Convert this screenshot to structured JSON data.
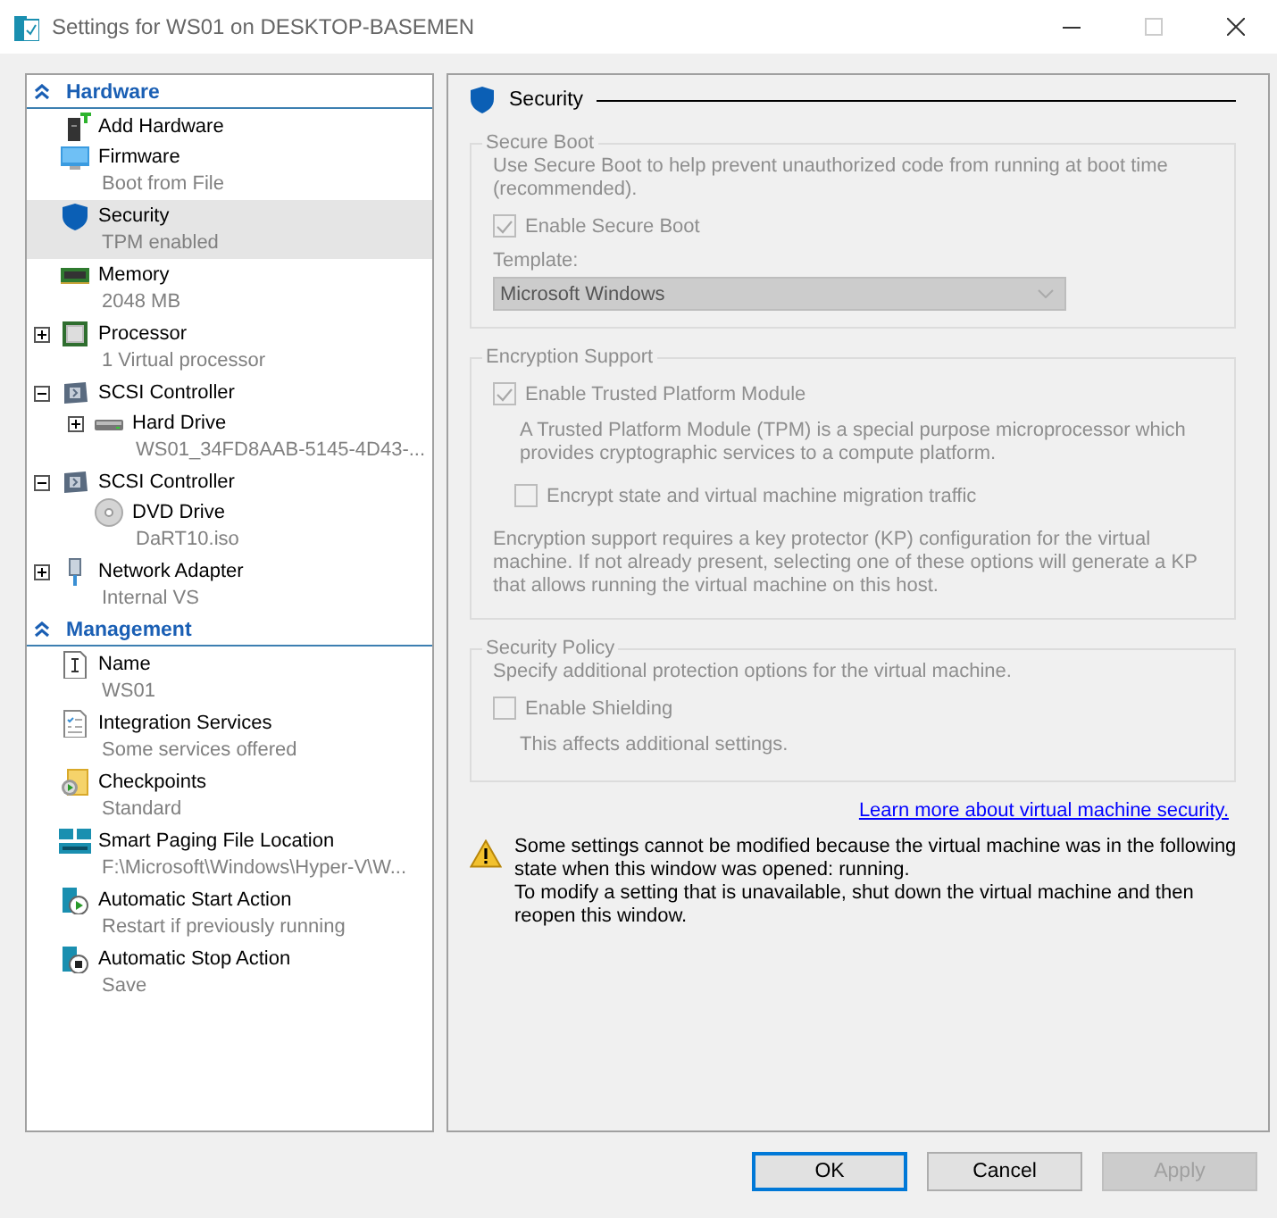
{
  "window": {
    "title": "Settings for WS01 on DESKTOP-BASEMEN"
  },
  "tree": {
    "sections": [
      {
        "title": "Hardware",
        "expanded": true,
        "items": [
          {
            "kind": "add-hardware",
            "name": "Add Hardware",
            "selected": false
          },
          {
            "kind": "firmware",
            "name": "Firmware",
            "detail": "Boot from File",
            "selected": false
          },
          {
            "kind": "security",
            "name": "Security",
            "detail": "TPM enabled",
            "selected": true
          },
          {
            "kind": "memory",
            "name": "Memory",
            "detail": "2048 MB",
            "selected": false
          },
          {
            "kind": "processor",
            "name": "Processor",
            "detail": "1 Virtual processor",
            "selected": false,
            "expanded": false
          },
          {
            "kind": "scsi",
            "name": "SCSI Controller",
            "selected": false,
            "expanded": true,
            "children": [
              {
                "kind": "disk",
                "name": "Hard Drive",
                "detail": "WS01_34FD8AAB-5145-4D43-...",
                "selected": false,
                "expanded": false
              }
            ]
          },
          {
            "kind": "scsi",
            "name": "SCSI Controller",
            "selected": false,
            "expanded": true,
            "children": [
              {
                "kind": "dvd",
                "name": "DVD Drive",
                "detail": "DaRT10.iso",
                "selected": false
              }
            ]
          },
          {
            "kind": "network",
            "name": "Network Adapter",
            "detail": "Internal VS",
            "selected": false,
            "expanded": false
          }
        ]
      },
      {
        "title": "Management",
        "expanded": true,
        "items": [
          {
            "kind": "name",
            "name": "Name",
            "detail": "WS01",
            "selected": false
          },
          {
            "kind": "integration",
            "name": "Integration Services",
            "detail": "Some services offered",
            "selected": false
          },
          {
            "kind": "checkpoints",
            "name": "Checkpoints",
            "detail": "Standard",
            "selected": false
          },
          {
            "kind": "paging",
            "name": "Smart Paging File Location",
            "detail": "F:\\Microsoft\\Windows\\Hyper-V\\W...",
            "selected": false
          },
          {
            "kind": "start",
            "name": "Automatic Start Action",
            "detail": "Restart if previously running",
            "selected": false
          },
          {
            "kind": "stop",
            "name": "Automatic Stop Action",
            "detail": "Save",
            "selected": false
          }
        ]
      }
    ]
  },
  "security": {
    "title": "Security",
    "groups": [
      {
        "legend": "Secure Boot",
        "disabled": true,
        "rows": [
          {
            "kind": "text",
            "text": "Use Secure Boot to help prevent unauthorized code from running at boot time (recommended)."
          },
          {
            "kind": "checkbox",
            "label": "Enable Secure Boot",
            "checked": true
          },
          {
            "kind": "label",
            "text": "Template:"
          },
          {
            "kind": "select",
            "value": "Microsoft Windows"
          }
        ]
      },
      {
        "legend": "Encryption Support",
        "disabled": true,
        "rows": [
          {
            "kind": "checkbox",
            "label": "Enable Trusted Platform Module",
            "checked": true
          },
          {
            "kind": "note",
            "text": "A Trusted Platform Module (TPM) is a special purpose microprocessor which provides cryptographic services to a compute platform."
          },
          {
            "kind": "sub-checkbox",
            "label": "Encrypt state and virtual machine migration traffic",
            "checked": false
          },
          {
            "kind": "text",
            "text": "Encryption support requires a key protector (KP) configuration for the virtual machine. If not already present, selecting one of these options will generate a KP that allows running the virtual machine on this host."
          }
        ]
      },
      {
        "legend": "Security Policy",
        "disabled": true,
        "rows": [
          {
            "kind": "text",
            "text": "Specify additional protection options for the virtual machine."
          },
          {
            "kind": "checkbox",
            "label": "Enable Shielding",
            "checked": false
          },
          {
            "kind": "note",
            "text": "This affects additional settings."
          }
        ]
      }
    ],
    "link": "Learn more about virtual machine security.",
    "warning": [
      "Some settings cannot be modified because the virtual machine was in the following state when this window was opened: running.",
      "To modify a setting that is unavailable, shut down the virtual machine and then reopen this window."
    ]
  },
  "buttons": [
    {
      "label": "OK",
      "default": true,
      "disabled": false
    },
    {
      "label": "Cancel",
      "default": false,
      "disabled": false
    },
    {
      "label": "Apply",
      "default": false,
      "disabled": true
    }
  ]
}
